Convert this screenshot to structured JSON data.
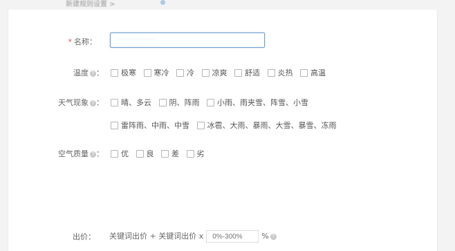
{
  "breadcrumb": {
    "text": "新建规则设置 >"
  },
  "form": {
    "name": {
      "required_mark": "*",
      "label": "名称：",
      "value": "···············"
    },
    "temperature": {
      "label": "温度",
      "colon": "：",
      "help": "?",
      "options": [
        "极寒",
        "寒冷",
        "冷",
        "凉爽",
        "舒适",
        "炎热",
        "高温"
      ]
    },
    "weather": {
      "label": "天气现象",
      "colon": "：",
      "help": "?",
      "options_row1": [
        "晴、多云",
        "阴、阵雨",
        "小雨、雨夹雪、阵雪、小雪"
      ],
      "options_row2": [
        "雷阵雨、中雨、中雪",
        "冰雹、大雨、暴雨、大雪、暴雪、冻雨"
      ]
    },
    "air_quality": {
      "label": "空气质量",
      "colon": "：",
      "help": "?",
      "options": [
        "优",
        "良",
        "差",
        "劣"
      ]
    },
    "bid": {
      "label": "出价：",
      "formula": "关键词出价 + 关键词出价 x",
      "placeholder": "0%-300%",
      "unit": "%",
      "help": "?"
    }
  }
}
